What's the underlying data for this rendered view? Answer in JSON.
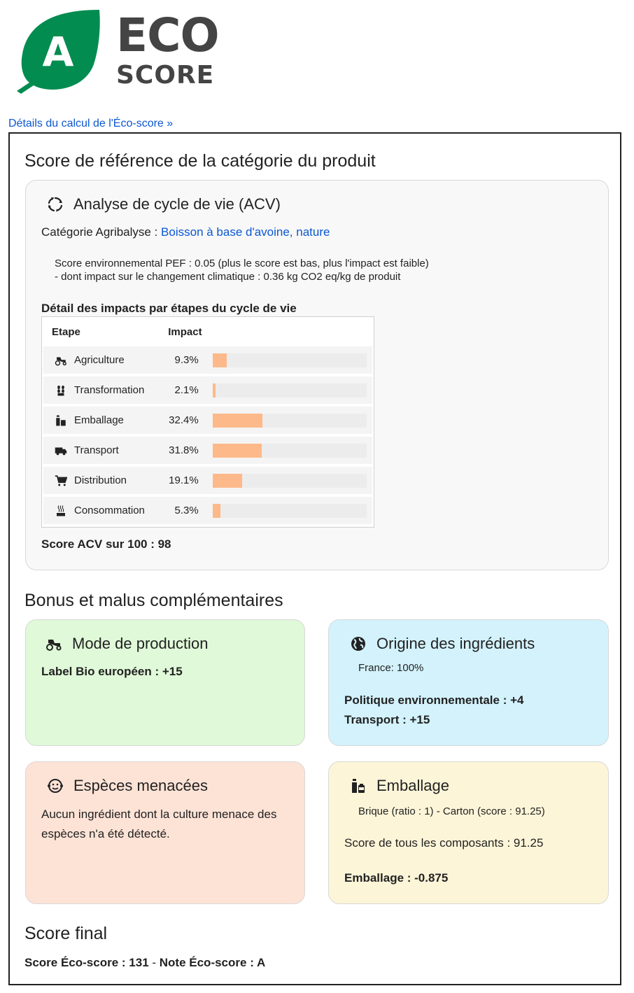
{
  "logo": {
    "grade": "A",
    "word1": "ECO",
    "word2": "SCORE"
  },
  "details_link": "Détails du calcul de l'Éco-score »",
  "reference": {
    "heading": "Score de référence de la catégorie du produit",
    "acv": {
      "title": "Analyse de cycle de vie (ACV)",
      "category_label": "Catégorie Agribalyse : ",
      "category_value": "Boisson à base d'avoine, nature",
      "pef_line1": "Score environnemental PEF : 0.05 (plus le score est bas, plus l'impact est faible)",
      "pef_line2": "- dont impact sur le changement climatique : 0.36 kg CO2 eq/kg de produit",
      "detail_heading": "Détail des impacts par étapes du cycle de vie",
      "col_step": "Etape",
      "col_impact": "Impact",
      "steps": [
        {
          "name": "Agriculture",
          "pct": "9.3%",
          "value": 9.3,
          "icon": "tractor-icon"
        },
        {
          "name": "Transformation",
          "pct": "2.1%",
          "value": 2.1,
          "icon": "grain-icon"
        },
        {
          "name": "Emballage",
          "pct": "32.4%",
          "value": 32.4,
          "icon": "bottle-icon"
        },
        {
          "name": "Transport",
          "pct": "31.8%",
          "value": 31.8,
          "icon": "truck-icon"
        },
        {
          "name": "Distribution",
          "pct": "19.1%",
          "value": 19.1,
          "icon": "cart-icon"
        },
        {
          "name": "Consommation",
          "pct": "5.3%",
          "value": 5.3,
          "icon": "steam-pot-icon"
        }
      ],
      "score": "Score ACV sur 100 : 98"
    }
  },
  "bonus": {
    "heading": "Bonus et malus complémentaires",
    "production": {
      "title": "Mode de production",
      "label": "Label Bio européen : +15"
    },
    "origin": {
      "title": "Origine des ingrédients",
      "countries": "France: 100%",
      "policy": "Politique environnementale : +4",
      "transport": "Transport : +15"
    },
    "species": {
      "title": "Espèces menacées",
      "text_line1": "Aucun ingrédient dont la culture menace des",
      "text_line2": "espèces n'a été détecté."
    },
    "packaging": {
      "title": "Emballage",
      "detail": "Brique (ratio : 1) - Carton (score : 91.25)",
      "components": "Score de tous les composants : 91.25",
      "result": "Emballage : -0.875"
    }
  },
  "final": {
    "heading": "Score final",
    "score_label": "Score Éco-score : 131",
    "separator": " - ",
    "grade_label": "Note Éco-score : A"
  },
  "colors": {
    "leaf": "#038c50",
    "bar": "#fdb98a",
    "production_bg": "#e0f9d8",
    "origin_bg": "#d3f2fc",
    "species_bg": "#fde3d6",
    "packaging_bg": "#fdf5d8",
    "acv_bg": "#f8f8f8"
  }
}
